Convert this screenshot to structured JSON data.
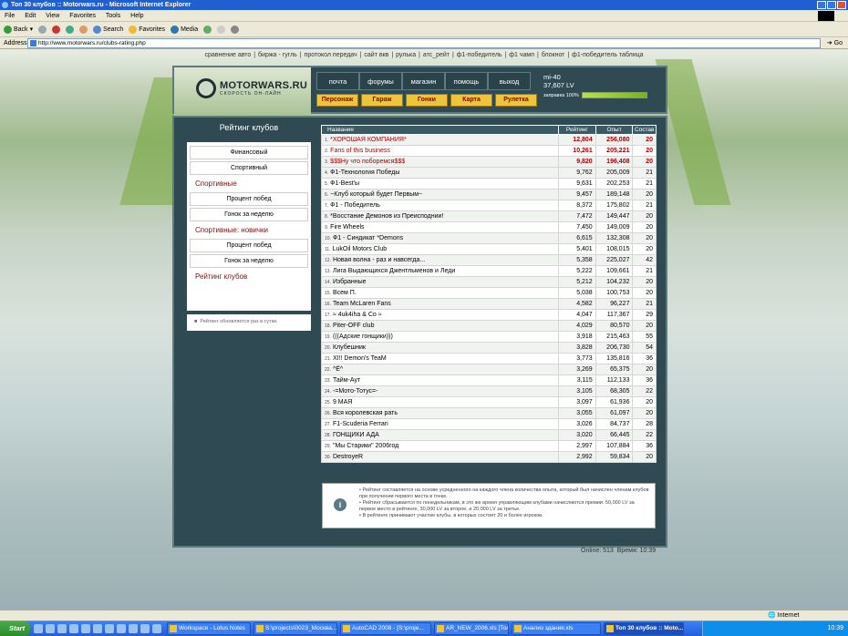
{
  "window": {
    "title": "Топ 30 клубов :: Motorwars.ru - Microsoft Internet Explorer"
  },
  "menu": [
    "File",
    "Edit",
    "View",
    "Favorites",
    "Tools",
    "Help"
  ],
  "toolbar": {
    "back": "Back",
    "search": "Search",
    "favorites": "Favorites",
    "media": "Media"
  },
  "address": {
    "label": "Address",
    "url": "http://www.motorwars.ru/clubs-rating.php",
    "go": "Go"
  },
  "topnav": [
    "сравнение авто",
    "биржа - гугль",
    "протокол передач",
    "сайт вкв",
    "рулька",
    "атс_рейт",
    "ф1-победитель",
    "ф1 чамп",
    "блокнот",
    "ф1-победитель таблица"
  ],
  "header": {
    "logo": "MOTORWARS.RU",
    "logo_sub": "СКОРОСТЬ ОН-ЛАЙН",
    "nav_top": [
      "почта",
      "форумы",
      "магазин",
      "помощь",
      "выход"
    ],
    "nav_bottom": [
      "Персонаж",
      "Гараж",
      "Гонки",
      "Карта",
      "Рулетка"
    ],
    "user": {
      "name": "mi-40",
      "money": "37,607 LV",
      "fuel_label": "заправка 100%",
      "fuel_level": 1.0
    }
  },
  "sidebar": {
    "title": "Рейтинг клубов",
    "items": [
      {
        "type": "button",
        "label": "Финансовый"
      },
      {
        "type": "button",
        "label": "Спортивный"
      },
      {
        "type": "head",
        "label": "Спортивные"
      },
      {
        "type": "button",
        "label": "Процент побед"
      },
      {
        "type": "button",
        "label": "Гонок за неделю"
      },
      {
        "type": "head",
        "label": "Спортивные: новички"
      },
      {
        "type": "button",
        "label": "Процент побед"
      },
      {
        "type": "button",
        "label": "Гонок за неделю"
      },
      {
        "type": "head",
        "label": "Рейтинг клубов"
      }
    ],
    "note": "Рейтинг обновляется раз в сутки."
  },
  "table": {
    "columns": [
      "Название",
      "Рейтинг",
      "Опыт",
      "Состав"
    ],
    "rows": [
      {
        "pos": "1.",
        "name": "*ХОРОШАЯ КОМПАНИЯ*",
        "rating": "12,804",
        "exp": "256,080",
        "members": "20",
        "top": true
      },
      {
        "pos": "2.",
        "name": "Fans of this business",
        "rating": "10,261",
        "exp": "205,221",
        "members": "20",
        "top": true
      },
      {
        "pos": "3.",
        "name": "$$$Ну что поборемся$$$",
        "rating": "9,820",
        "exp": "196,408",
        "members": "20",
        "top": true
      },
      {
        "pos": "4.",
        "name": "Ф1-Технология Победы",
        "rating": "9,762",
        "exp": "205,009",
        "members": "21",
        "top": false
      },
      {
        "pos": "5.",
        "name": "Ф1-Best'ы",
        "rating": "9,631",
        "exp": "202,253",
        "members": "21",
        "top": false
      },
      {
        "pos": "6.",
        "name": "~Клуб который будет Первым~",
        "rating": "9,457",
        "exp": "189,148",
        "members": "20",
        "top": false
      },
      {
        "pos": "7.",
        "name": "Ф1 - Победитель",
        "rating": "8,372",
        "exp": "175,802",
        "members": "21",
        "top": false
      },
      {
        "pos": "8.",
        "name": "*Восстание Демонов из Преисподнии!",
        "rating": "7,472",
        "exp": "149,447",
        "members": "20",
        "top": false
      },
      {
        "pos": "9.",
        "name": "Fire Wheels",
        "rating": "7,450",
        "exp": "149,009",
        "members": "20",
        "top": false
      },
      {
        "pos": "10.",
        "name": "Ф1 - Синдикат *Demons",
        "rating": "6,615",
        "exp": "132,308",
        "members": "20",
        "top": false
      },
      {
        "pos": "11.",
        "name": "LukOil Motors Club",
        "rating": "5,401",
        "exp": "108,015",
        "members": "20",
        "top": false
      },
      {
        "pos": "12.",
        "name": "Новая волна - раз и навсегда...",
        "rating": "5,358",
        "exp": "225,027",
        "members": "42",
        "top": false
      },
      {
        "pos": "13.",
        "name": "Лига Выдающихся Джентльменов и Леди",
        "rating": "5,222",
        "exp": "109,661",
        "members": "21",
        "top": false
      },
      {
        "pos": "14.",
        "name": "Избранные",
        "rating": "5,212",
        "exp": "104,232",
        "members": "20",
        "top": false
      },
      {
        "pos": "15.",
        "name": "Всем П.",
        "rating": "5,038",
        "exp": "100,753",
        "members": "20",
        "top": false
      },
      {
        "pos": "16.",
        "name": "Team McLaren Fans",
        "rating": "4,582",
        "exp": "96,227",
        "members": "21",
        "top": false
      },
      {
        "pos": "17.",
        "name": "≈ 4uk4iha & Co ≈",
        "rating": "4,047",
        "exp": "117,367",
        "members": "29",
        "top": false
      },
      {
        "pos": "18.",
        "name": "Piter-OFF club",
        "rating": "4,029",
        "exp": "80,570",
        "members": "20",
        "top": false
      },
      {
        "pos": "19.",
        "name": "(((Адские гонщики)))",
        "rating": "3,918",
        "exp": "215,463",
        "members": "55",
        "top": false
      },
      {
        "pos": "20.",
        "name": "Клубешник",
        "rating": "3,828",
        "exp": "206,730",
        "members": "54",
        "top": false
      },
      {
        "pos": "21.",
        "name": "XI!! Demon's TeaM",
        "rating": "3,773",
        "exp": "135,816",
        "members": "36",
        "top": false
      },
      {
        "pos": "22.",
        "name": "^Ё^",
        "rating": "3,269",
        "exp": "65,375",
        "members": "20",
        "top": false
      },
      {
        "pos": "23.",
        "name": "Тайм-Аут",
        "rating": "3,115",
        "exp": "112,133",
        "members": "36",
        "top": false
      },
      {
        "pos": "24.",
        "name": "-=Мото-Тотус=-",
        "rating": "3,105",
        "exp": "68,305",
        "members": "22",
        "top": false
      },
      {
        "pos": "25.",
        "name": "9 МАЯ",
        "rating": "3,097",
        "exp": "61,936",
        "members": "20",
        "top": false
      },
      {
        "pos": "26.",
        "name": "Вся королевская рать",
        "rating": "3,055",
        "exp": "61,097",
        "members": "20",
        "top": false
      },
      {
        "pos": "27.",
        "name": "F1-Scuderia Ferrari",
        "rating": "3,026",
        "exp": "84,737",
        "members": "28",
        "top": false
      },
      {
        "pos": "28.",
        "name": "ГОНЩИКИ АДА",
        "rating": "3,020",
        "exp": "66,445",
        "members": "22",
        "top": false
      },
      {
        "pos": "29.",
        "name": "\"Мы Старики\" 2006год",
        "rating": "2,997",
        "exp": "107,884",
        "members": "36",
        "top": false
      },
      {
        "pos": "30.",
        "name": "DestroyeR",
        "rating": "2,992",
        "exp": "59,834",
        "members": "20",
        "top": false
      }
    ]
  },
  "info": [
    "Рейтинг составляется на основе усредненного на каждого члена количества опыта, который был начислен членам клубов при получении первого места в гонке.",
    "Рейтинг сбрасывается по понедельникам, в это же время управляющим клубами начисляются премии: 50,000 LV за первое место в рейтинге, 30,000 LV за второе, и 20,000 LV за третье.",
    "В рейтинге принимают участие клубы, в которых состоит 20 и более игроков."
  ],
  "footer": {
    "online": "Online: 513",
    "time": "Время: 10:39"
  },
  "statusbar": {
    "zone": "Internet"
  },
  "taskbar": {
    "start": "Start",
    "tasks": [
      {
        "label": "Workspace - Lotus Notes",
        "width": 92
      },
      {
        "label": "S:\\projects\\0023_Москва...",
        "width": 92
      },
      {
        "label": "AutoCAD 2008 - [S:\\proje...",
        "width": 100
      },
      {
        "label": "AR_NEW_2006.xls [Тольк...",
        "width": 82
      },
      {
        "label": "Анализ здания.xls",
        "width": 98
      },
      {
        "label": "Топ 30 клубов :: Moto...",
        "width": 88,
        "active": true
      }
    ],
    "clock": "10:39"
  }
}
